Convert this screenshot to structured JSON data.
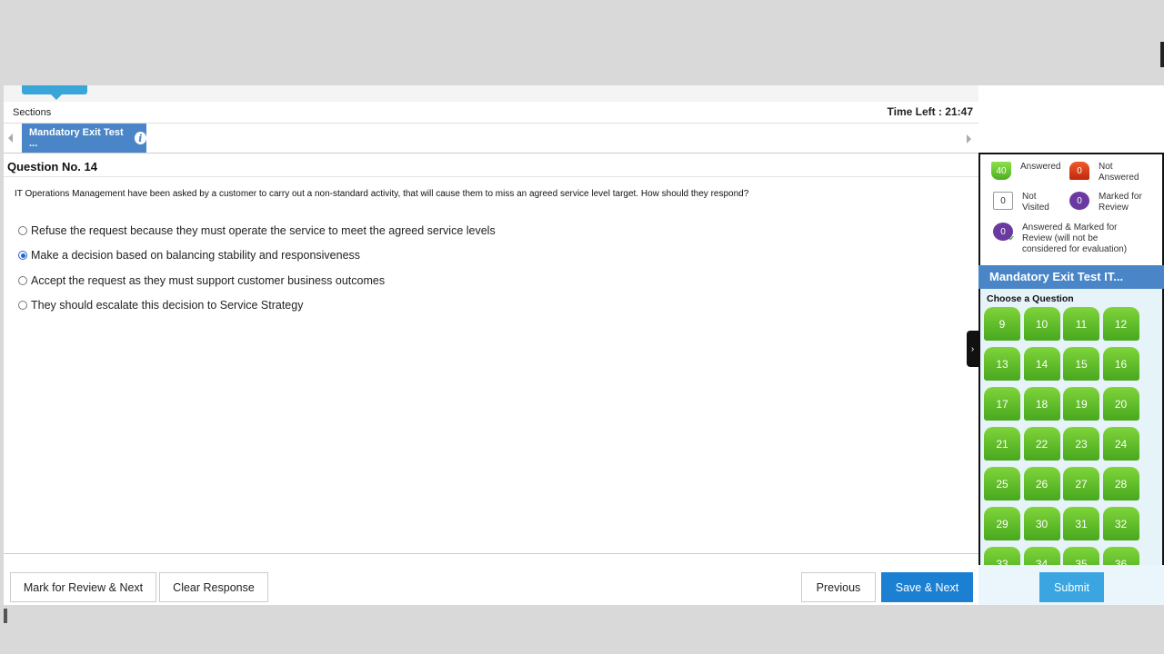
{
  "header": {
    "sections_label": "Sections",
    "time_left": "Time Left : 21:47"
  },
  "section_tab": {
    "label": "Mandatory Exit Test ...",
    "info_icon": "i"
  },
  "question": {
    "number_label": "Question No. 14",
    "text": "IT Operations Management have been asked by a customer to carry out a non-standard activity, that will cause them to miss an agreed service level target. How should they respond?",
    "options": [
      {
        "label": "Refuse the request because they must operate the service to meet the agreed service levels",
        "selected": false
      },
      {
        "label": "Make a decision based on balancing stability and responsiveness",
        "selected": true
      },
      {
        "label": "Accept the request as they must support customer business outcomes",
        "selected": false
      },
      {
        "label": "They should escalate this decision to Service Strategy",
        "selected": false
      }
    ]
  },
  "legend": {
    "answered_count": "40",
    "answered_label": "Answered",
    "not_answered_count": "0",
    "not_answered_label": "Not Answered",
    "not_visited_count": "0",
    "not_visited_label": "Not Visited",
    "marked_count": "0",
    "marked_label": "Marked for Review",
    "answered_marked_count": "0",
    "answered_marked_label": "Answered & Marked for Review (will not be considered for evaluation)"
  },
  "palette": {
    "section_title": "Mandatory Exit Test IT...",
    "choose_label": "Choose a Question",
    "questions": [
      "9",
      "10",
      "11",
      "12",
      "13",
      "14",
      "15",
      "16",
      "17",
      "18",
      "19",
      "20",
      "21",
      "22",
      "23",
      "24",
      "25",
      "26",
      "27",
      "28",
      "29",
      "30",
      "31",
      "32",
      "33",
      "34",
      "35",
      "36"
    ]
  },
  "footer": {
    "mark_review_next": "Mark for Review & Next",
    "clear_response": "Clear Response",
    "previous": "Previous",
    "save_next": "Save & Next",
    "submit": "Submit"
  },
  "colors": {
    "accent_blue": "#1b7fd2",
    "section_blue": "#4a86c7",
    "answered_green": "#48a81e",
    "not_answered_red": "#c0290c",
    "marked_purple": "#6b3aa0"
  }
}
